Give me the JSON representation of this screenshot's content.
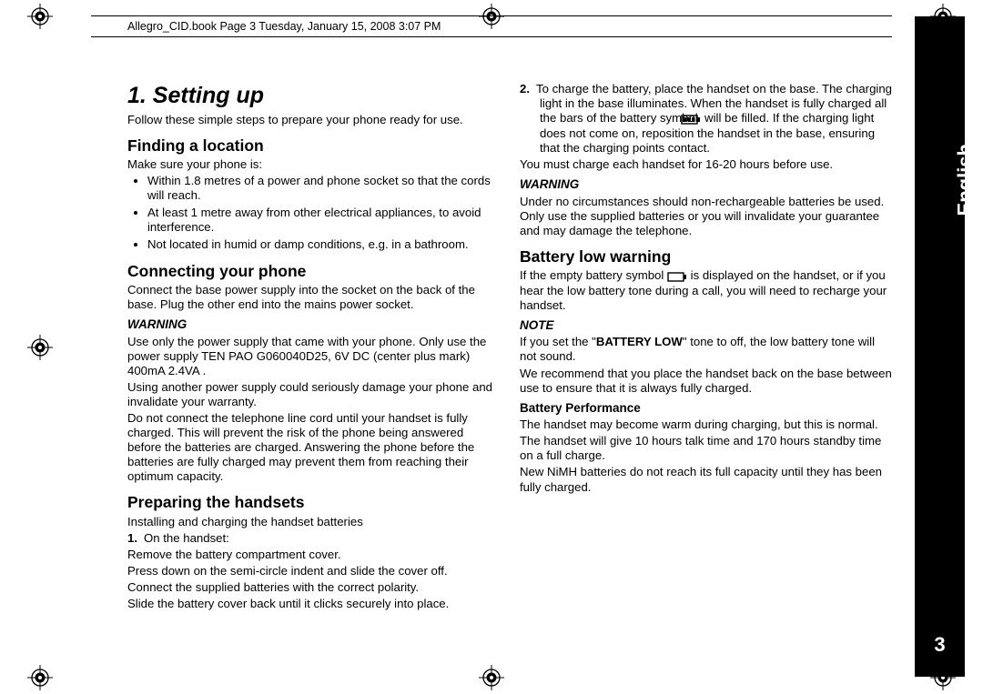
{
  "running_head": "Allegro_CID.book  Page 3  Tuesday, January 15, 2008  3:07 PM",
  "side_tab": {
    "language": "English",
    "page_number": "3"
  },
  "h1": "1. Setting up",
  "intro": "Follow these simple steps to prepare your phone ready for use.",
  "h2_finding": "Finding a location",
  "finding_lead": "Make sure your phone is:",
  "finding_bullets": [
    "Within 1.8 metres of a power and phone socket so that the cords will reach.",
    "At least 1 metre away from other electrical appliances, to avoid interference.",
    "Not located in humid or damp conditions, e.g. in a bathroom."
  ],
  "h2_connecting": "Connecting your phone",
  "connecting_p": "Connect the base power supply into the socket on the back of the base. Plug the other end into the mains power socket.",
  "warn_label": "WARNING",
  "warn1_p1": "Use only the power supply that came with your phone. Only use the power supply TEN PAO G060040D25,  6V DC (center plus mark) 400mA 2.4VA .",
  "warn1_p2": "Using another power supply could seriously damage your phone and invalidate your warranty.",
  "warn1_p3": "Do not connect the telephone line cord until your handset is fully charged. This will prevent the risk of the phone being answered before the batteries are charged. Answering the phone before the batteries are fully charged may prevent them from reaching their optimum capacity.",
  "h2_preparing": "Preparing the handsets",
  "prep_lead": "Installing and charging the handset batteries",
  "prep_step1a": "On the handset:",
  "prep_step1b": "Remove the battery compartment cover.",
  "prep_step1c": "Press down on the semi-circle indent and slide the cover off.",
  "prep_step1d": "Connect the supplied batteries with the correct polarity.",
  "prep_step1e": "Slide the battery cover back until it clicks securely into place.",
  "prep_step2a": "To charge the battery, place the handset on the base. The charging light in the base illuminates. When the handset is fully charged all the bars of the battery symbol ",
  "prep_step2b": " will be filled. If the charging light does not come on, reposition the handset in the base, ensuring that the charging points contact.",
  "prep_after": "You must charge each handset for 16-20 hours before use.",
  "warn2_p": "Under no circumstances should non-rechargeable batteries be used. Only use the supplied batteries or you will invalidate your guarantee and may damage the telephone.",
  "h2_battlow": "Battery low warning",
  "battlow_p1a": "If the empty battery symbol ",
  "battlow_p1b": " is displayed on the handset, or if you hear the low battery tone during a call, you will need to recharge your handset.",
  "note_label": "NOTE",
  "note_p1a": "If you set the \"",
  "note_p1b": "BATTERY LOW",
  "note_p1c": "\" tone to off, the low battery tone will not sound.",
  "note_p2": "We recommend that you place the handset back on the base between use to ensure that it is always fully charged.",
  "h3_batperf": "Battery Performance",
  "batperf_p1": "The handset may become warm during charging, but this is normal.",
  "batperf_p2": "The handset will give 10 hours talk time and 170 hours standby time on a full charge.",
  "batperf_p3": "New NiMH batteries do not reach its full capacity until they has been fully charged."
}
